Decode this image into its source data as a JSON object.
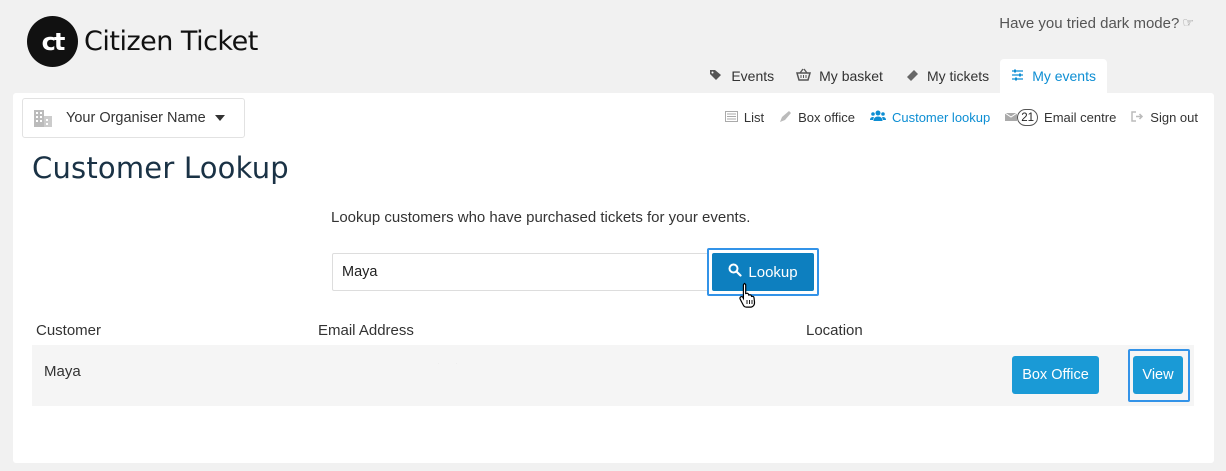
{
  "brand": {
    "logo_mark": "ct",
    "name": "Citizen Ticket"
  },
  "dark_mode": {
    "text": "Have you tried dark mode?",
    "icon": "pointing-hand-icon"
  },
  "top_tabs": [
    {
      "label": "Events",
      "icon": "tags-icon",
      "active": false
    },
    {
      "label": "My basket",
      "icon": "basket-icon",
      "active": false
    },
    {
      "label": "My tickets",
      "icon": "ticket-icon",
      "active": false
    },
    {
      "label": "My events",
      "icon": "sliders-icon",
      "active": true
    }
  ],
  "organiser": {
    "label": "Your Organiser Name",
    "icon": "building-icon"
  },
  "sub_nav": [
    {
      "label": "List",
      "icon": "list-icon",
      "active": false
    },
    {
      "label": "Box office",
      "icon": "pencil-icon",
      "active": false
    },
    {
      "label": "Customer lookup",
      "icon": "users-icon",
      "active": true
    },
    {
      "label": "Email centre",
      "icon": "envelope-icon",
      "badge": "21",
      "active": false
    },
    {
      "label": "Sign out",
      "icon": "sign-out-icon",
      "active": false
    }
  ],
  "page": {
    "title": "Customer Lookup",
    "intro": "Lookup customers who have purchased tickets for your events."
  },
  "search": {
    "value": "Maya",
    "button_label": "Lookup"
  },
  "table": {
    "headers": [
      "Customer",
      "Email Address",
      "Location"
    ],
    "rows": [
      {
        "customer": "Maya",
        "email": "· ·",
        "location": "",
        "actions": [
          "Box Office",
          "View"
        ]
      }
    ]
  },
  "colors": {
    "accent": "#0d8ed3",
    "button": "#1a9ad6",
    "focus_ring": "#3393e8",
    "title": "#1a3245"
  }
}
